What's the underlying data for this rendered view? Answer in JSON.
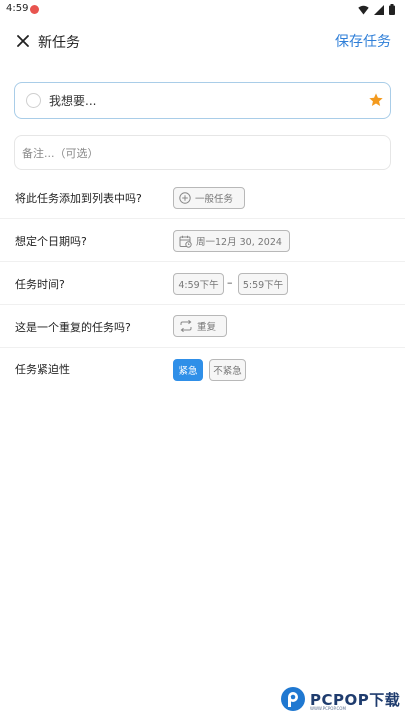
{
  "status_bar": {
    "time": "4:59"
  },
  "header": {
    "title": "新任务",
    "save_label": "保存任务",
    "accent_color": "#2f7fd8"
  },
  "task_input": {
    "placeholder": "我想要...",
    "star_color": "#f39a1e"
  },
  "note_input": {
    "placeholder": "备注...（可选）"
  },
  "rows": {
    "list": {
      "label": "将此任务添加到列表中吗?",
      "chip": "一般任务"
    },
    "date": {
      "label": "想定个日期吗?",
      "chip": "周一12月 30, 2024"
    },
    "time": {
      "label": "任务时间?",
      "start": "4:59下午",
      "separator": "–",
      "end": "5:59下午"
    },
    "repeat": {
      "label": "这是一个重复的任务吗?",
      "chip": "重复"
    },
    "urgency": {
      "label": "任务紧迫性",
      "option_urgent": "紧急",
      "option_not_urgent": "不紧急",
      "selected": "紧急"
    }
  },
  "watermark": {
    "text": "PCPOP下载",
    "subtext": "WWW.PCPOP.COM"
  }
}
